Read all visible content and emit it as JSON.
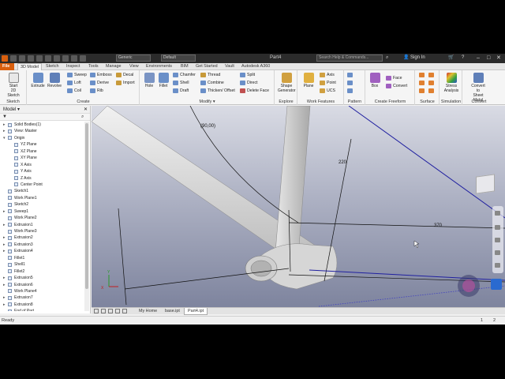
{
  "app": {
    "document_title": "Part4",
    "search_placeholder": "Search Help & Commands...",
    "sign_in": "Sign In",
    "material": "Generic",
    "appearance": "Default",
    "win_minimize": "–",
    "win_maximize": "□",
    "win_close": "✕"
  },
  "ribbon_tabs": [
    {
      "label": "File"
    },
    {
      "label": "3D Model"
    },
    {
      "label": "Sketch"
    },
    {
      "label": "Inspect"
    },
    {
      "label": "Tools"
    },
    {
      "label": "Manage"
    },
    {
      "label": "View"
    },
    {
      "label": "Environments"
    },
    {
      "label": "BIM"
    },
    {
      "label": "Get Started"
    },
    {
      "label": "Vault"
    },
    {
      "label": "Autodesk A360"
    }
  ],
  "ribbon": {
    "sketch": {
      "label": "Sketch",
      "start_sketch_1": "Start",
      "start_sketch_2": "2D Sketch"
    },
    "create": {
      "label": "Create",
      "extrude": "Extrude",
      "revolve": "Revolve",
      "sweep": "Sweep",
      "loft": "Loft",
      "coil": "Coil",
      "emboss": "Emboss",
      "derive": "Derive",
      "rib": "Rib",
      "decal": "Decal",
      "import": "Import"
    },
    "modify": {
      "label": "Modify ▾",
      "hole": "Hole",
      "fillet": "Fillet",
      "chamfer": "Chamfer",
      "shell": "Shell",
      "draft": "Draft",
      "thread": "Thread",
      "combine": "Combine",
      "thicken": "Thicken/ Offset",
      "split": "Split",
      "direct": "Direct",
      "delete_face": "Delete Face"
    },
    "explore": {
      "label": "Explore",
      "shape_generator_1": "Shape",
      "shape_generator_2": "Generator"
    },
    "work_features": {
      "label": "Work Features",
      "plane": "Plane",
      "axis": "Axis",
      "point": "Point",
      "ucs": "UCS"
    },
    "pattern": {
      "label": "Pattern"
    },
    "freeform": {
      "label": "Create Freeform",
      "box": "Box",
      "face": "Face",
      "convert": "Convert"
    },
    "surface": {
      "label": "Surface"
    },
    "simulation": {
      "label": "Simulation",
      "stress_1": "Stress",
      "stress_2": "Analysis"
    },
    "convert": {
      "label": "Convert",
      "sheet_1": "Convert to",
      "sheet_2": "Sheet Metal"
    }
  },
  "browser": {
    "title": "Model ▾",
    "close": "✕",
    "items": [
      {
        "label": "Solid Bodies(1)",
        "indent": 1,
        "twisty": "▸"
      },
      {
        "label": "View: Master",
        "indent": 1,
        "twisty": "▸"
      },
      {
        "label": "Origin",
        "indent": 1,
        "twisty": "▾"
      },
      {
        "label": "YZ Plane",
        "indent": 2,
        "twisty": ""
      },
      {
        "label": "XZ Plane",
        "indent": 2,
        "twisty": ""
      },
      {
        "label": "XY Plane",
        "indent": 2,
        "twisty": ""
      },
      {
        "label": "X Axis",
        "indent": 2,
        "twisty": ""
      },
      {
        "label": "Y Axis",
        "indent": 2,
        "twisty": ""
      },
      {
        "label": "Z Axis",
        "indent": 2,
        "twisty": ""
      },
      {
        "label": "Center Point",
        "indent": 2,
        "twisty": ""
      },
      {
        "label": "Sketch1",
        "indent": 1,
        "twisty": ""
      },
      {
        "label": "Work Plane1",
        "indent": 1,
        "twisty": ""
      },
      {
        "label": "Sketch2",
        "indent": 1,
        "twisty": ""
      },
      {
        "label": "Sweep1",
        "indent": 1,
        "twisty": "▸"
      },
      {
        "label": "Work Plane2",
        "indent": 1,
        "twisty": ""
      },
      {
        "label": "Extrusion1",
        "indent": 1,
        "twisty": "▸"
      },
      {
        "label": "Work Plane3",
        "indent": 1,
        "twisty": ""
      },
      {
        "label": "Extrusion2",
        "indent": 1,
        "twisty": "▸"
      },
      {
        "label": "Extrusion3",
        "indent": 1,
        "twisty": "▸"
      },
      {
        "label": "Extrusion4",
        "indent": 1,
        "twisty": "▸"
      },
      {
        "label": "Fillet1",
        "indent": 1,
        "twisty": ""
      },
      {
        "label": "Shell1",
        "indent": 1,
        "twisty": ""
      },
      {
        "label": "Fillet2",
        "indent": 1,
        "twisty": ""
      },
      {
        "label": "Extrusion5",
        "indent": 1,
        "twisty": "▸"
      },
      {
        "label": "Extrusion6",
        "indent": 1,
        "twisty": "▸"
      },
      {
        "label": "Work Plane4",
        "indent": 1,
        "twisty": ""
      },
      {
        "label": "Extrusion7",
        "indent": 1,
        "twisty": "▸"
      },
      {
        "label": "Extrusion8",
        "indent": 1,
        "twisty": "▸"
      },
      {
        "label": "End of Part",
        "indent": 1,
        "twisty": ""
      }
    ]
  },
  "viewport": {
    "dim_angle": "(90,00)",
    "dim_vertical": "220",
    "dim_horizontal": "370",
    "axis_x": "X",
    "axis_y": "Y"
  },
  "doc_tabs": [
    {
      "label": "My Home"
    },
    {
      "label": "base.ipt"
    },
    {
      "label": "Part4.ipt"
    }
  ],
  "status": {
    "text": "Ready",
    "count_a": "1",
    "count_b": "2"
  }
}
